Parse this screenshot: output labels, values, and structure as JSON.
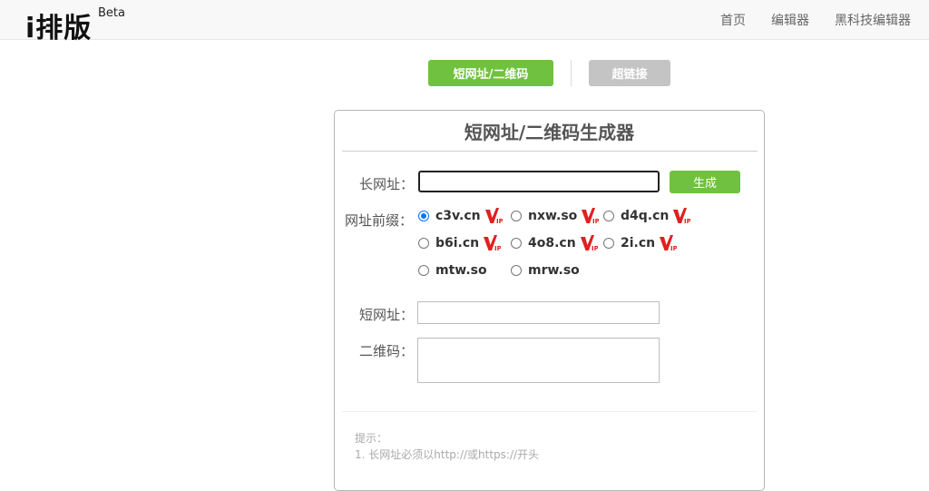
{
  "header": {
    "logo_text": "i排版",
    "logo_badge": "Beta",
    "nav": [
      {
        "label": "首页"
      },
      {
        "label": "编辑器"
      },
      {
        "label": "黑科技编辑器"
      }
    ]
  },
  "tabs": {
    "active_label": "短网址/二维码",
    "inactive_label": "超链接"
  },
  "panel": {
    "title": "短网址/二维码生成器",
    "long_url": {
      "label": "长网址：",
      "value": ""
    },
    "generate_label": "生成",
    "prefix_label": "网址前缀：",
    "prefixes": [
      {
        "domain": "c3v.cn",
        "vip": true,
        "checked": true
      },
      {
        "domain": "nxw.so",
        "vip": true,
        "checked": false
      },
      {
        "domain": "d4q.cn",
        "vip": true,
        "checked": false
      },
      {
        "domain": "b6i.cn",
        "vip": true,
        "checked": false
      },
      {
        "domain": "4o8.cn",
        "vip": true,
        "checked": false
      },
      {
        "domain": "2i.cn",
        "vip": true,
        "checked": false
      },
      {
        "domain": "mtw.so",
        "vip": false,
        "checked": false
      },
      {
        "domain": "mrw.so",
        "vip": false,
        "checked": false
      }
    ],
    "short_url": {
      "label": "短网址：",
      "value": ""
    },
    "qr_code": {
      "label": "二维码："
    },
    "tips": {
      "heading": "提示：",
      "line1": "1. 长网址必须以http://或https://开头"
    }
  },
  "colors": {
    "accent_green": "#70c13f",
    "inactive_gray": "#c4c4c4",
    "vip_red": "#e02020"
  }
}
